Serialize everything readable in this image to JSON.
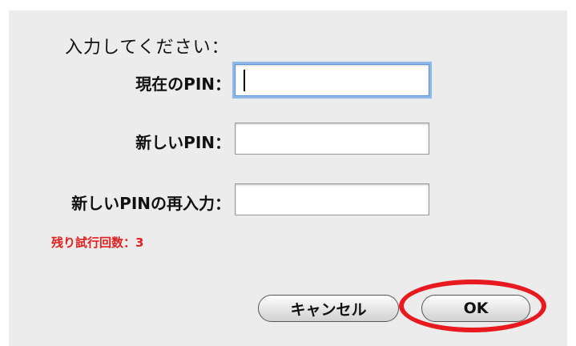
{
  "dialog": {
    "prompt": "入力してください：",
    "fields": [
      {
        "label": "現在のPIN：",
        "value": "",
        "focused": true
      },
      {
        "label": "新しいPIN：",
        "value": ""
      },
      {
        "label": "新しいPINの再入力：",
        "value": ""
      }
    ],
    "remaining_attempts": "残り試行回数：3",
    "buttons": {
      "cancel_label": "キャンセル",
      "ok_label": "OK"
    }
  },
  "colors": {
    "warning_text": "#e32020",
    "highlight_ring": "#e8191f",
    "focus_ring": "#8fb7ea"
  }
}
